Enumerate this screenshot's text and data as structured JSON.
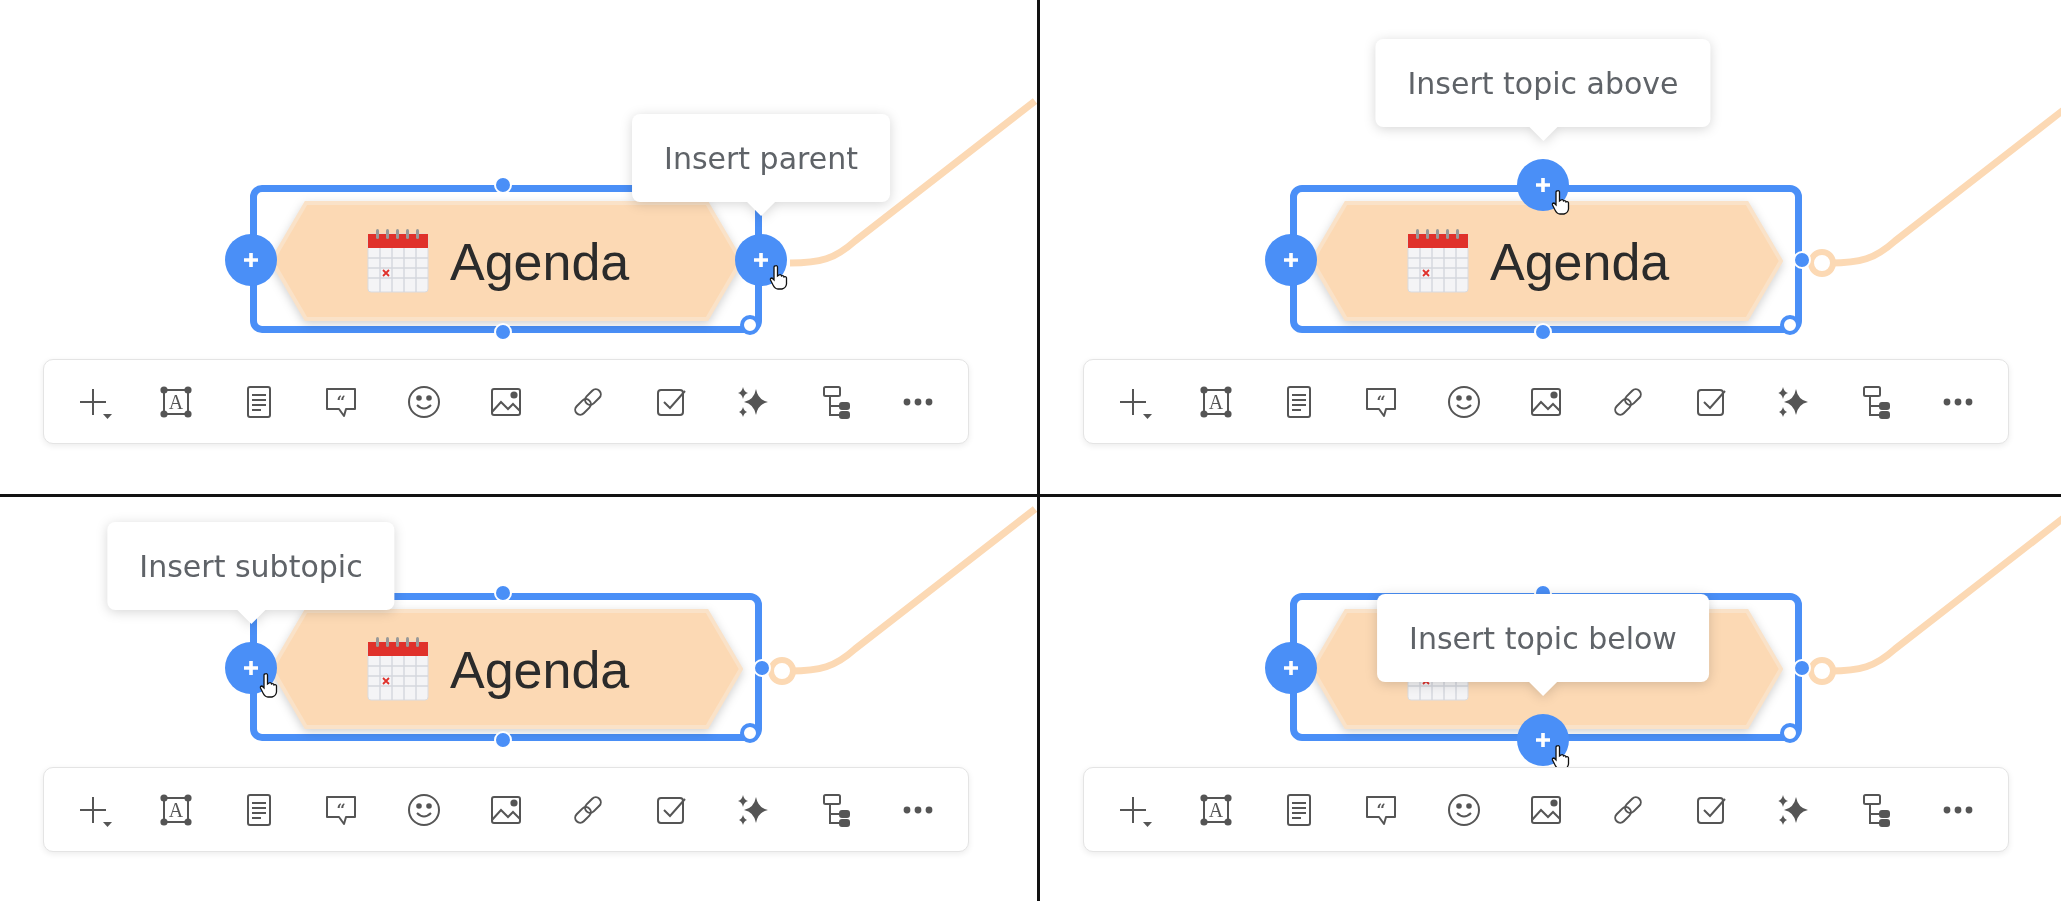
{
  "panels": [
    {
      "handles": [
        {
          "kind": "subtopic",
          "hovered": false
        },
        {
          "kind": "parent",
          "hovered": true
        },
        {
          "kind": "above",
          "hovered": false
        },
        {
          "kind": "below",
          "hovered": false
        }
      ],
      "tooltip": "Insert parent",
      "label": "Agenda",
      "toolbar": [
        {
          "kind": "insert"
        },
        {
          "kind": "text",
          "glyph": "A"
        },
        {
          "kind": "note"
        },
        {
          "kind": "comment",
          "glyph": "“"
        },
        {
          "kind": "emoji"
        },
        {
          "kind": "image"
        },
        {
          "kind": "link"
        },
        {
          "kind": "task"
        },
        {
          "kind": "ai"
        },
        {
          "kind": "structure"
        },
        {
          "kind": "more"
        }
      ]
    },
    {
      "handles": [
        {
          "kind": "subtopic",
          "hovered": false
        },
        {
          "kind": "parent",
          "hovered": false
        },
        {
          "kind": "above",
          "hovered": true
        },
        {
          "kind": "below",
          "hovered": false
        }
      ],
      "tooltip": "Insert topic above",
      "label": "Agenda",
      "toolbar": [
        {
          "kind": "insert"
        },
        {
          "kind": "text",
          "glyph": "A"
        },
        {
          "kind": "note"
        },
        {
          "kind": "comment",
          "glyph": "“"
        },
        {
          "kind": "emoji"
        },
        {
          "kind": "image"
        },
        {
          "kind": "link"
        },
        {
          "kind": "task"
        },
        {
          "kind": "ai"
        },
        {
          "kind": "structure"
        },
        {
          "kind": "more"
        }
      ]
    },
    {
      "handles": [
        {
          "kind": "subtopic",
          "hovered": true
        },
        {
          "kind": "parent",
          "hovered": false
        },
        {
          "kind": "above",
          "hovered": false
        },
        {
          "kind": "below",
          "hovered": false
        }
      ],
      "tooltip": "Insert subtopic",
      "label": "Agenda",
      "toolbar": [
        {
          "kind": "insert"
        },
        {
          "kind": "text",
          "glyph": "A"
        },
        {
          "kind": "note"
        },
        {
          "kind": "comment",
          "glyph": "“"
        },
        {
          "kind": "emoji"
        },
        {
          "kind": "image"
        },
        {
          "kind": "link"
        },
        {
          "kind": "task"
        },
        {
          "kind": "ai"
        },
        {
          "kind": "structure"
        },
        {
          "kind": "more"
        }
      ]
    },
    {
      "handles": [
        {
          "kind": "subtopic",
          "hovered": false
        },
        {
          "kind": "parent",
          "hovered": false
        },
        {
          "kind": "above",
          "hovered": false
        },
        {
          "kind": "below",
          "hovered": true
        }
      ],
      "tooltip": "Insert topic below",
      "toolbar": [
        {
          "kind": "insert"
        },
        {
          "kind": "text",
          "glyph": "A"
        },
        {
          "kind": "note"
        },
        {
          "kind": "comment",
          "glyph": "“"
        },
        {
          "kind": "emoji"
        },
        {
          "kind": "image"
        },
        {
          "kind": "link"
        },
        {
          "kind": "task"
        },
        {
          "kind": "ai"
        },
        {
          "kind": "structure"
        },
        {
          "kind": "more"
        }
      ]
    }
  ]
}
